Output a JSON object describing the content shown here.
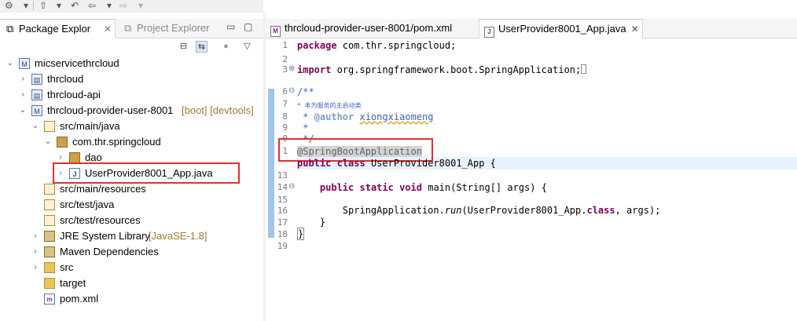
{
  "left_tabs": {
    "package_explorer": "Package Explor",
    "project_explorer": "Project Explorer",
    "package_explorer_close": "✕"
  },
  "tree": {
    "root": "micservicethrcloud",
    "items": [
      {
        "label": "thrcloud",
        "deco": ""
      },
      {
        "label": "thrcloud-api",
        "deco": ""
      },
      {
        "label": "thrcloud-provider-user-8001",
        "deco": "[boot] [devtools]"
      },
      {
        "label": "src/main/java",
        "deco": ""
      },
      {
        "label": "com.thr.springcloud",
        "deco": ""
      },
      {
        "label": "dao",
        "deco": ""
      },
      {
        "label": "UserProvider8001_App.java",
        "deco": ""
      },
      {
        "label": "src/main/resources",
        "deco": ""
      },
      {
        "label": "src/test/java",
        "deco": ""
      },
      {
        "label": "src/test/resources",
        "deco": ""
      },
      {
        "label": "JRE System Library",
        "deco": "[JavaSE-1.8]"
      },
      {
        "label": "Maven Dependencies",
        "deco": ""
      },
      {
        "label": "src",
        "deco": ""
      },
      {
        "label": "target",
        "deco": ""
      },
      {
        "label": "pom.xml",
        "deco": ""
      }
    ]
  },
  "editor_tabs": {
    "pom": "thrcloud-provider-user-8001/pom.xml",
    "java": "UserProvider8001_App.java",
    "java_close": "✕"
  },
  "code": {
    "line_numbers": [
      "1",
      "2",
      "3",
      "6",
      "7",
      "8",
      "9",
      "0",
      "1",
      "13",
      "14",
      "15",
      "16",
      "17",
      "18",
      "19"
    ],
    "l1_kw": "package",
    "l1_rest": " com.thr.springcloud;",
    "l3_kw": "import",
    "l3_rest": " org.springframework.boot.SpringApplication;",
    "l6": "/**",
    "l7_cjk": "* 本为服务的主启动类",
    "l8_star": " * ",
    "l8_tag": "@author",
    "l8_name": "xiongxiaomeng",
    "l9": " *",
    "l10": " */",
    "l11_ann": "@SpringBootApplication",
    "l12_kw1": "public",
    "l12_kw2": "class",
    "l12_rest": " UserProvider8001_App {",
    "l14_kw1": "public",
    "l14_kw2": "static",
    "l14_kw3": "void",
    "l14_rest": " main(String[] args) {",
    "l16_a": "SpringApplication.",
    "l16_run": "run",
    "l16_b": "(UserProvider8001_App.",
    "l16_kw": "class",
    "l16_c": ", args);",
    "l17": "}",
    "l18": "}"
  },
  "colors": {
    "highlight_box": "#e03131",
    "keyword": "#7f0055",
    "comment": "#3f5fbf"
  }
}
